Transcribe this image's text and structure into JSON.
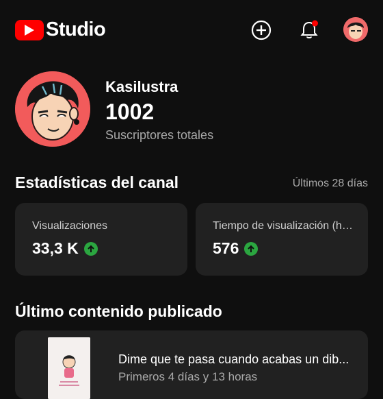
{
  "header": {
    "app_title": "Studio",
    "brand_color": "#ff0000",
    "notification_dot_color": "#ff0000"
  },
  "channel": {
    "name": "Kasilustra",
    "subscribers": "1002",
    "subscribers_label": "Suscriptores totales"
  },
  "stats": {
    "title": "Estadísticas del canal",
    "period": "Últimos 28 días",
    "cards": [
      {
        "label": "Visualizaciones",
        "value": "33,3 K",
        "trend": "up"
      },
      {
        "label": "Tiempo de visualización (ho...",
        "value": "576",
        "trend": "up"
      }
    ],
    "trend_color": "#2ba640"
  },
  "latest": {
    "title": "Último contenido publicado",
    "video": {
      "title": "Dime que te pasa cuando acabas un dib...",
      "subtitle": "Primeros 4 días y 13 horas"
    }
  }
}
